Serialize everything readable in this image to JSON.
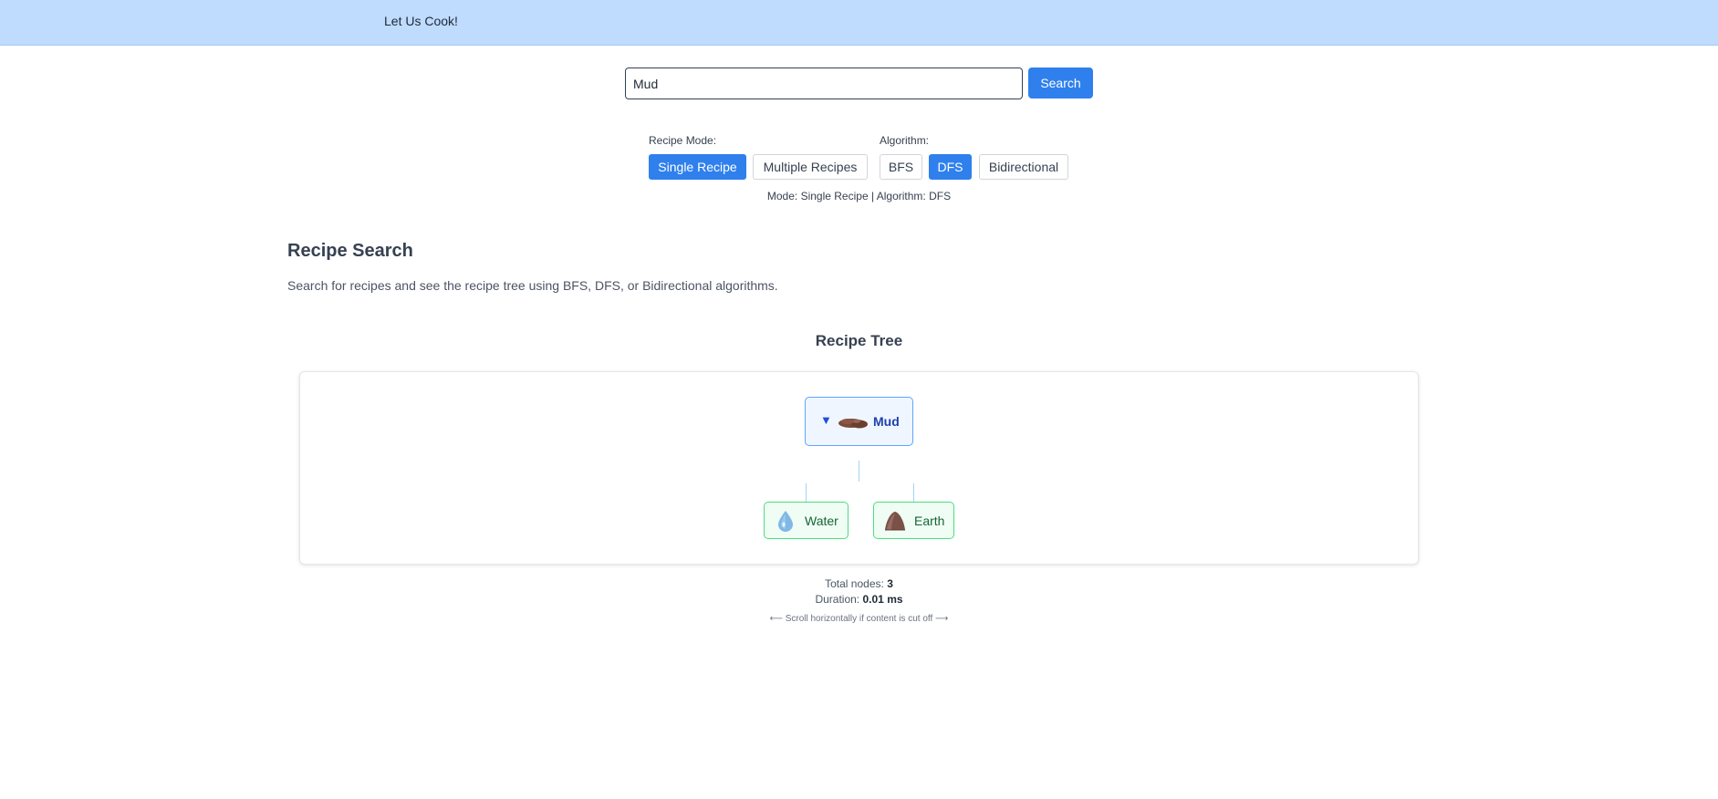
{
  "header": {
    "brand": "Let Us Cook!"
  },
  "search": {
    "value": "Mud",
    "button_label": "Search"
  },
  "controls": {
    "recipe_mode_label": "Recipe Mode:",
    "recipe_modes": [
      "Single Recipe",
      "Multiple Recipes"
    ],
    "selected_mode": "Single Recipe",
    "algorithm_label": "Algorithm:",
    "algorithms": [
      "BFS",
      "DFS",
      "Bidirectional"
    ],
    "selected_algorithm": "DFS",
    "status_text": "Mode: Single Recipe | Algorithm: DFS"
  },
  "section": {
    "title": "Recipe Search",
    "description": "Search for recipes and see the recipe tree using BFS, DFS, or Bidirectional algorithms."
  },
  "tree": {
    "title": "Recipe Tree",
    "root": {
      "label": "Mud",
      "toggle": "▼",
      "icon": "mud-icon"
    },
    "children": [
      {
        "label": "Water",
        "icon": "water-drop-icon"
      },
      {
        "label": "Earth",
        "icon": "earth-mound-icon"
      }
    ]
  },
  "stats": {
    "total_nodes_label": "Total nodes:",
    "total_nodes": "3",
    "duration_label": "Duration:",
    "duration": "0.01 ms",
    "scroll_hint": "⟵ Scroll horizontally if content is cut off ⟶"
  },
  "colors": {
    "topbar": "#bfdbfe",
    "accent": "#2f80ed",
    "root_border": "#60a5fa",
    "child_border": "#4ade80"
  }
}
